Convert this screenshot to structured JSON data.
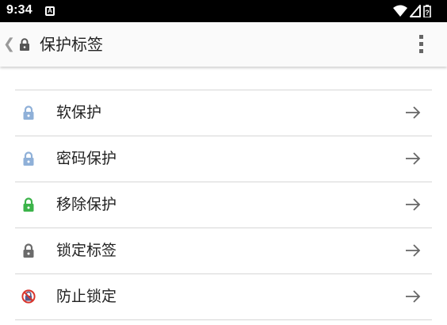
{
  "status_bar": {
    "time": "9:34",
    "notification_icon_letter": "A"
  },
  "toolbar": {
    "title": "保护标签",
    "back_icon": "chevron-left-icon",
    "title_icon": "lock-icon",
    "menu_icon": "more-vert-icon"
  },
  "list": {
    "items": [
      {
        "label": "软保护",
        "icon": "lock-icon",
        "icon_color": "#8fb0d8"
      },
      {
        "label": "密码保护",
        "icon": "lock-icon",
        "icon_color": "#8fb0d8"
      },
      {
        "label": "移除保护",
        "icon": "lock-icon",
        "icon_color": "#3cb34a"
      },
      {
        "label": "锁定标签",
        "icon": "lock-icon",
        "icon_color": "#6b6b6b"
      },
      {
        "label": "防止锁定",
        "icon": "no-lock-icon",
        "icon_color": "#d9342b"
      }
    ],
    "arrow_icon": "arrow-right-icon"
  },
  "colors": {
    "status_bar_bg": "#000000",
    "toolbar_bg": "#fafafa",
    "divider": "#d6d6d6",
    "text": "#222222"
  }
}
